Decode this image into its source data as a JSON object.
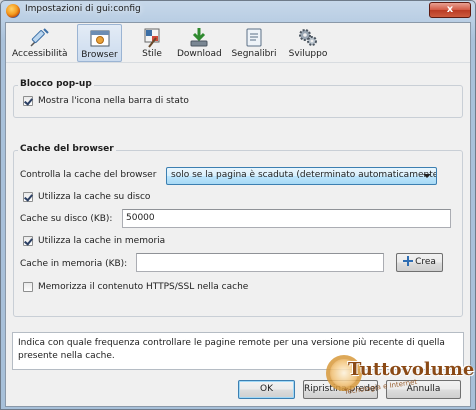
{
  "window": {
    "title": "Impostazioni di gui:config",
    "close_label": "x"
  },
  "toolbar": {
    "items": [
      {
        "label": "Accessibilità",
        "icon": "syringe-icon",
        "selected": false
      },
      {
        "label": "Browser",
        "icon": "browser-window-icon",
        "selected": true
      },
      {
        "label": "Stile",
        "icon": "paintbrush-icon",
        "selected": false
      },
      {
        "label": "Download",
        "icon": "download-arrow-icon",
        "selected": false
      },
      {
        "label": "Segnalibri",
        "icon": "bookmarks-icon",
        "selected": false
      },
      {
        "label": "Sviluppo",
        "icon": "gears-icon",
        "selected": false
      }
    ]
  },
  "popup_group": {
    "title": "Blocco pop-up",
    "show_icon_label": "Mostra l'icona nella barra di stato",
    "show_icon_checked": true
  },
  "cache_group": {
    "title": "Cache del browser",
    "control_label": "Controlla la cache del browser",
    "control_value": "solo se la pagina è scaduta (determinato automaticamente)",
    "disk_cache_label": "Utilizza la cache su disco",
    "disk_cache_checked": true,
    "disk_size_label": "Cache su disco (KB):",
    "disk_size_value": "50000",
    "memory_cache_label": "Utilizza la cache in memoria",
    "memory_cache_checked": true,
    "memory_size_label": "Cache in memoria (KB):",
    "memory_size_value": "",
    "create_label": "Crea",
    "ssl_label": "Memorizza il contenuto HTTPS/SSL nella cache",
    "ssl_checked": false
  },
  "description": "Indica con quale frequenza controllare le pagine remote per una versione più recente di quella presente nella cache.",
  "buttons": {
    "ok": "OK",
    "restore": "Ripristina predefiniti",
    "cancel": "Annulla"
  },
  "watermark": {
    "brand": "Tuttovolume",
    "tagline": "Tecnologia e Internet"
  },
  "colors": {
    "accent": "#3c7fb1",
    "window_frame": "#a9c1da",
    "close_button": "#c94a32"
  }
}
